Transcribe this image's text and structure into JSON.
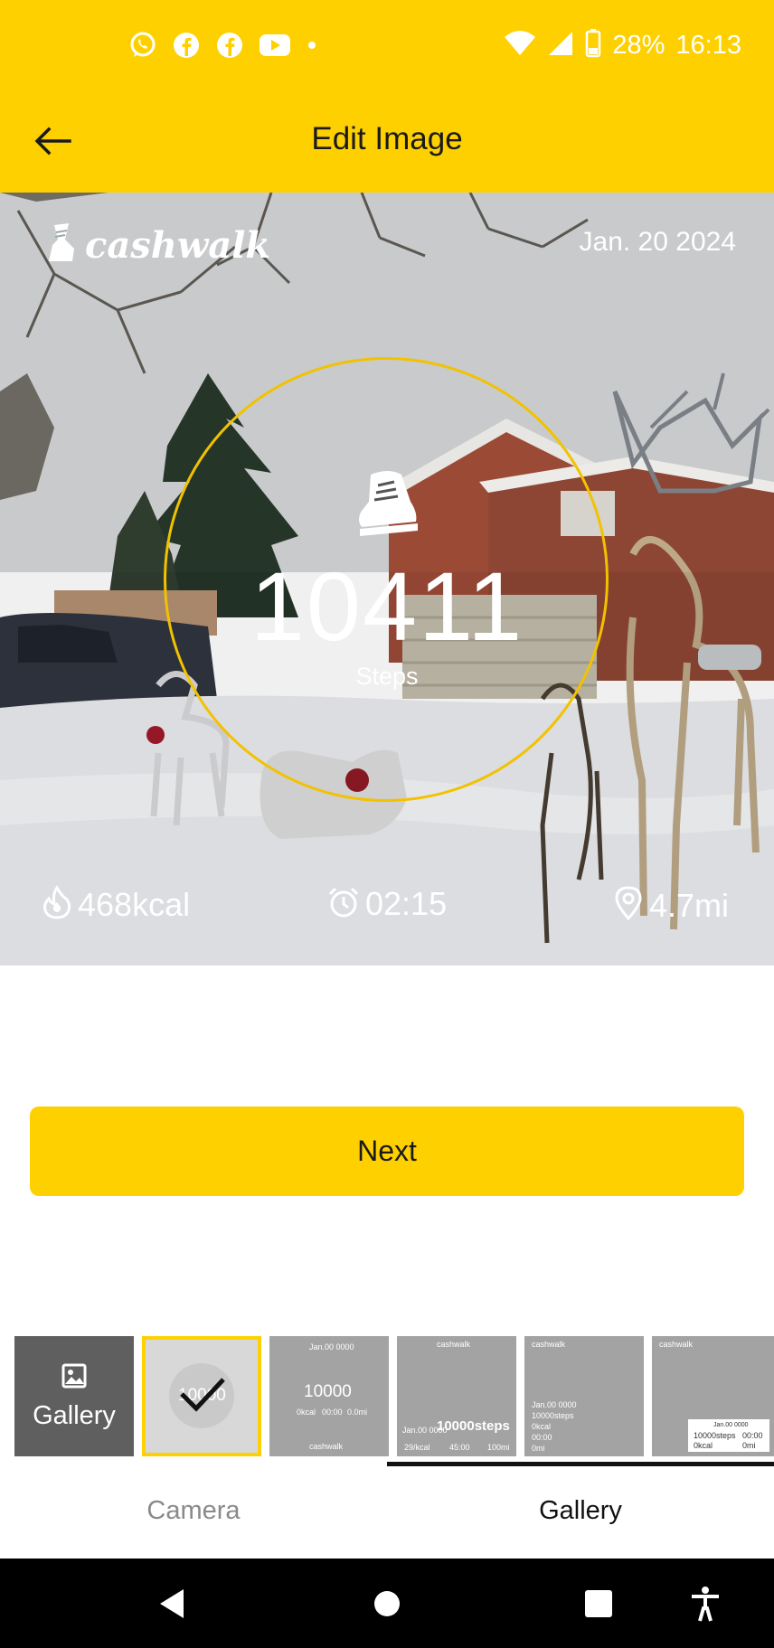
{
  "status_bar": {
    "battery": "28%",
    "time": "16:13",
    "left_icons": [
      "whatsapp-icon",
      "facebook-icon",
      "facebook-icon",
      "youtube-icon",
      "dot-icon"
    ],
    "right_icons": [
      "wifi-icon",
      "signal-icon",
      "battery-icon"
    ]
  },
  "header": {
    "title": "Edit Image",
    "back_icon": "arrow-left-icon"
  },
  "photo_card": {
    "brand": "cashwalk",
    "date": "Jan. 20 2024",
    "steps_value": "10411",
    "steps_label": "Steps",
    "calories": "468kcal",
    "duration": "02:15",
    "distance": "4.7mi",
    "accent_color": "#F2C200"
  },
  "actions": {
    "next_label": "Next"
  },
  "templates": {
    "gallery_label": "Gallery",
    "items": [
      {
        "selected": true,
        "value": "10000"
      },
      {
        "date": "Jan.00 0000",
        "value": "10000",
        "stats": [
          "0kcal",
          "00:00",
          "0.0mi"
        ],
        "brand": "cashwalk"
      },
      {
        "brand": "cashwalk",
        "date": "Jan.00 0000",
        "value": "10000steps",
        "stats": [
          "29/kcal",
          "45:00",
          "100mi"
        ]
      },
      {
        "brand": "cashwalk",
        "lines": [
          "Jan.00 0000",
          "10000steps",
          "0kcal",
          "00:00",
          "0mi"
        ]
      },
      {
        "brand": "cashwalk",
        "date": "Jan.00 0000",
        "lines": [
          "10000steps",
          "00:00",
          "0kcal",
          "0mi"
        ]
      }
    ]
  },
  "tabs": [
    {
      "label": "Camera",
      "active": false
    },
    {
      "label": "Gallery",
      "active": true
    }
  ],
  "nav_bar": {
    "icons": [
      "back-triangle-icon",
      "home-circle-icon",
      "recents-square-icon",
      "accessibility-icon"
    ]
  },
  "colors": {
    "primary": "#FFD000",
    "nav_background": "#000000",
    "tab_inactive": "#8a8a8a"
  }
}
